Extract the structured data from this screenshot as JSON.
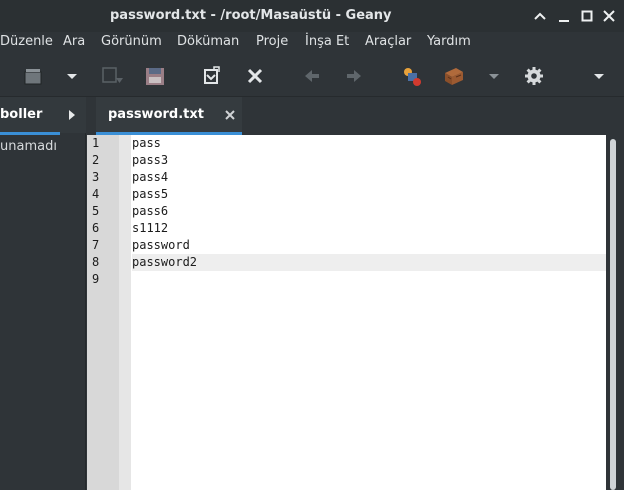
{
  "window": {
    "title": "password.txt - /root/Masaüstü - Geany",
    "controls": [
      {
        "name": "chevron-up-icon",
        "action": "shade"
      },
      {
        "name": "minimize-icon",
        "action": "minimize"
      },
      {
        "name": "maximize-icon",
        "action": "maximize"
      },
      {
        "name": "close-icon",
        "action": "close"
      }
    ]
  },
  "menubar": {
    "items": [
      "Düzenle",
      "Ara",
      "Görünüm",
      "Döküman",
      "Proje",
      "İnşa Et",
      "Araçlar",
      "Yardım"
    ]
  },
  "toolbar": {
    "icons": [
      "open-file-icon",
      "dropdown-arrow-icon",
      "save-icon",
      "save-all-icon",
      "revert-icon",
      "close-file-icon",
      "back-icon",
      "forward-icon",
      "compile-icon",
      "build-icon",
      "build-dropdown-icon",
      "settings-gear-icon",
      "overflow-menu-icon"
    ]
  },
  "sidebar": {
    "tab_label": "boller",
    "message": "unamadı"
  },
  "document_tab": {
    "label": "password.txt",
    "close_icon": "close-tab-icon"
  },
  "editor": {
    "lines": [
      "pass",
      "pass3",
      "pass4",
      "pass5",
      "pass6",
      "s1112",
      "password",
      "password2",
      ""
    ],
    "line_numbers": [
      "1",
      "2",
      "3",
      "4",
      "5",
      "6",
      "7",
      "8",
      "9"
    ],
    "current_line": 8
  },
  "colors": {
    "accent": "#3a8fd6",
    "chrome": "#2f3438",
    "editor_bg": "#ffffff",
    "gutter_bg": "#d8d8d8"
  }
}
